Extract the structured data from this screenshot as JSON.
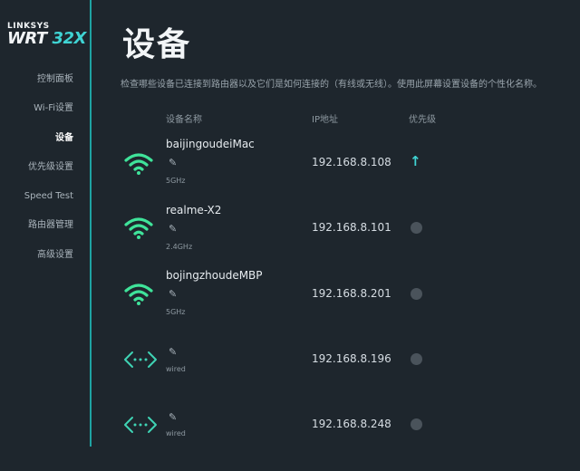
{
  "brand": {
    "top": "LINKSYS",
    "bottom_main": "WRT",
    "bottom_accent": "32X"
  },
  "nav": [
    {
      "label": "控制面板"
    },
    {
      "label": "Wi-Fi设置"
    },
    {
      "label": "设备"
    },
    {
      "label": "优先级设置"
    },
    {
      "label": "Speed Test"
    },
    {
      "label": "路由器管理"
    },
    {
      "label": "高级设置"
    }
  ],
  "page": {
    "title": "设备",
    "description": "检查哪些设备已连接到路由器以及它们是如何连接的（有线或无线）。使用此屏幕设置设备的个性化名称。"
  },
  "columns": {
    "name": "设备名称",
    "ip": "IP地址",
    "priority": "优先级"
  },
  "devices": [
    {
      "name": "baijingoudeiMac",
      "band": "5GHz",
      "ip": "192.168.8.108",
      "connection": "wifi-icon",
      "priority": "prioritized-arrow-up-icon"
    },
    {
      "name": "realme-X2",
      "band": "2.4GHz",
      "ip": "192.168.8.101",
      "connection": "wifi-icon",
      "priority": "not-prioritized"
    },
    {
      "name": "bojingzhoudeMBP",
      "band": "5GHz",
      "ip": "192.168.8.201",
      "connection": "wifi-icon",
      "priority": "not-prioritized"
    },
    {
      "name": "",
      "band": "wired",
      "ip": "192.168.8.196",
      "connection": "ethernet-icon",
      "priority": "not-prioritized"
    },
    {
      "name": "",
      "band": "wired",
      "ip": "192.168.8.248",
      "connection": "ethernet-icon",
      "priority": "not-prioritized"
    }
  ],
  "colors": {
    "background": "#1e262d",
    "accent": "#3fd3d3",
    "wifi": "#3fe39a",
    "ethernet": "#3fd3b4"
  }
}
